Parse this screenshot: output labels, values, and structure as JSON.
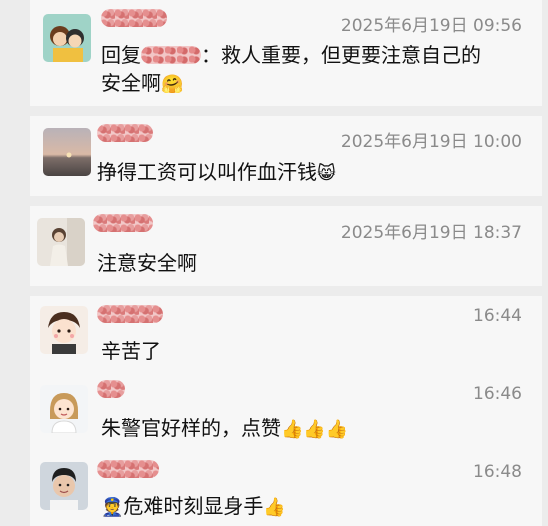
{
  "comments": [
    {
      "time": "2025年6月19日 09:56",
      "reply_prefix": "回复",
      "text_line1": "：救人重要，但更要注意自己的",
      "text_line2": "安全啊",
      "emoji": "🤗"
    },
    {
      "time": "2025年6月19日 10:00",
      "text": "挣得工资可以叫作血汗钱",
      "emoji": "😸"
    },
    {
      "time": "2025年6月19日 18:37",
      "text": "注意安全啊"
    },
    {
      "time": "16:44",
      "text": "辛苦了"
    },
    {
      "time": "16:46",
      "text": "朱警官好样的，点赞",
      "emoji": "👍👍👍"
    },
    {
      "time": "16:48",
      "emoji_prefix": "👮",
      "text": "危难时刻显身手",
      "emoji": "👍"
    }
  ],
  "colors": {
    "background": "#ececec",
    "card": "#f7f7f7",
    "timestamp": "#8a8a8a",
    "text": "#111111",
    "name_mask": "#f2c6c6"
  }
}
